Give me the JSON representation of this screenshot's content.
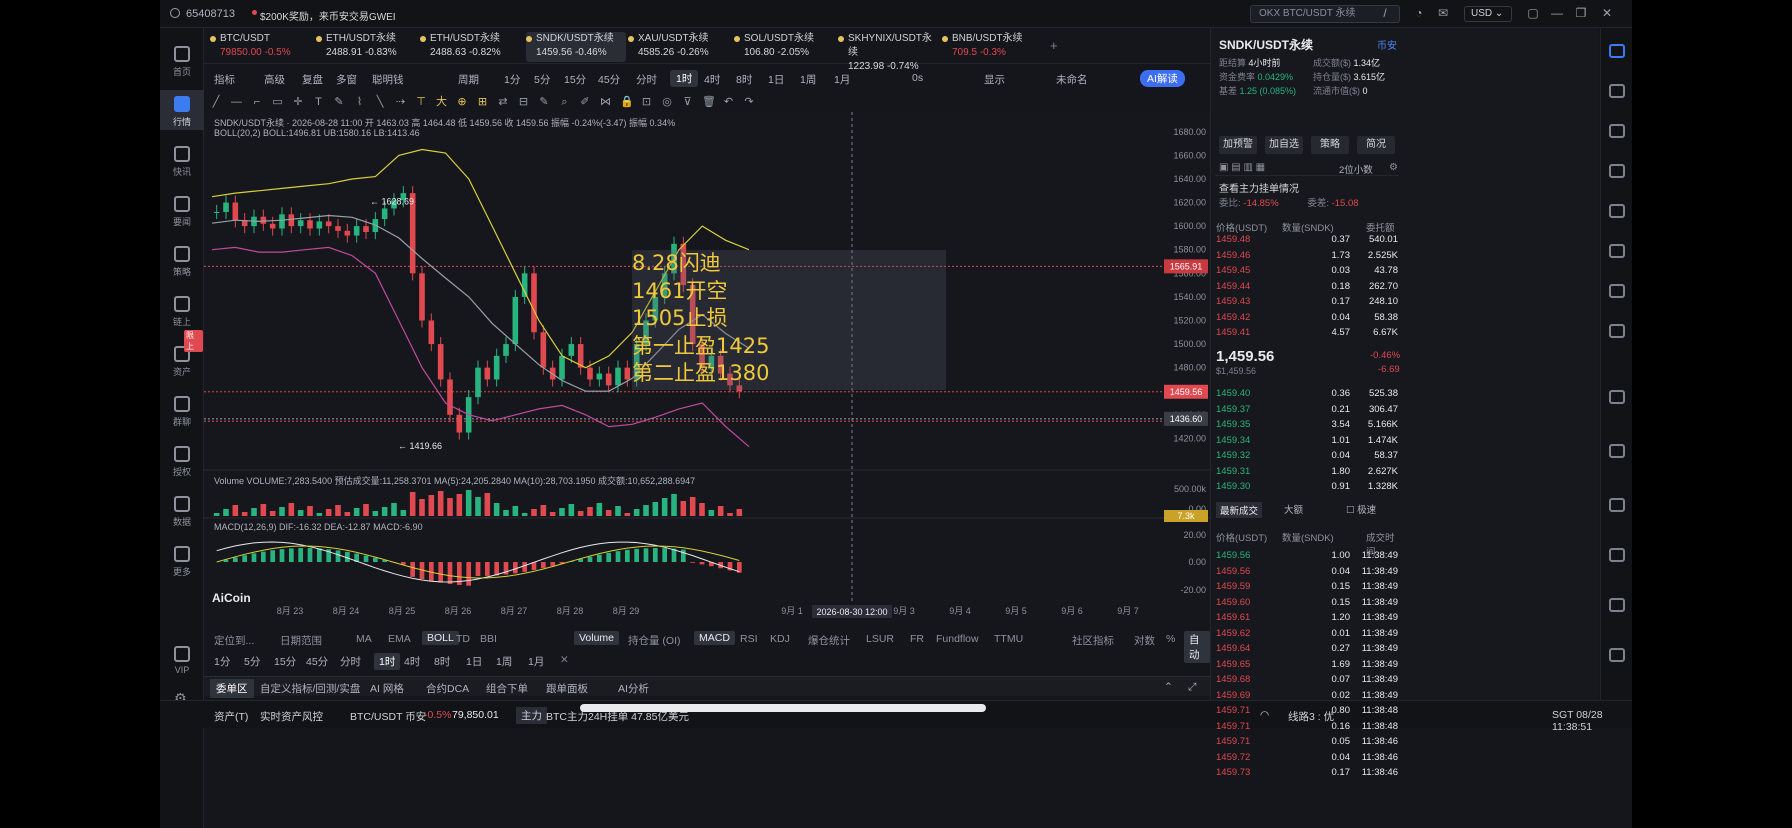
{
  "titlebar": {
    "uid": "65408713",
    "promo": "$200K奖励，来币安交易GWEI",
    "search_placeholder": "OKX BTC/USDT 永续",
    "currency": "USD"
  },
  "leftnav": [
    "首页",
    "行情",
    "快讯",
    "要闻",
    "策略",
    "链上",
    "资产",
    "群聊",
    "授权",
    "数据",
    "更多",
    "VIP"
  ],
  "leftnav_badge": "限上",
  "tabs": [
    {
      "name": "BTC/USDT",
      "price": "79850.00",
      "chg": "-0.5%",
      "color": "red"
    },
    {
      "name": "ETH/USDT永续",
      "price": "2488.91",
      "chg": "-0.83%",
      "color": "white"
    },
    {
      "name": "ETH/USDT永续",
      "price": "2488.63",
      "chg": "-0.82%",
      "color": "white"
    },
    {
      "name": "SNDK/USDT永续",
      "price": "1459.56",
      "chg": "-0.46%",
      "color": "white"
    },
    {
      "name": "XAU/USDT永续",
      "price": "4585.26",
      "chg": "-0.26%",
      "color": "white"
    },
    {
      "name": "SOL/USDT永续",
      "price": "106.80",
      "chg": "-2.05%",
      "color": "white"
    },
    {
      "name": "SKHYNIX/USDT永续",
      "price": "1223.98",
      "chg": "-0.74%",
      "color": "white"
    },
    {
      "name": "BNB/USDT永续",
      "price": "709.5",
      "chg": "-0.3%",
      "color": "red"
    }
  ],
  "toolbar1": [
    "指标",
    "高级",
    "复盘",
    "多窗",
    "聪明钱",
    "周期",
    "1分",
    "5分",
    "15分",
    "45分",
    "分时",
    "1时",
    "4时",
    "8时",
    "1日",
    "1周",
    "1月",
    "0s",
    "显示",
    "未命名",
    "AI解读"
  ],
  "toolbar1_selected": "1时",
  "chart": {
    "title_line": "SNDK/USDT永续 · 2026-08-28 11:00  开 1463.03  高 1464.48  低 1459.56  收 1459.56  振幅 -0.24%(-3.47)  振幅 0.34%",
    "boll_line": "BOLL(20,2)  BOLL:1496.81  UB:1580.16  LB:1413.46",
    "y_ticks": [
      "1680.00",
      "1660.00",
      "1640.00",
      "1620.00",
      "1600.00",
      "1580.00",
      "1560.00",
      "1540.00",
      "1520.00",
      "1500.00",
      "1480.00",
      "1460.00",
      "1440.00",
      "1420.00"
    ],
    "price_tags": {
      "line1": "1565.91",
      "current": "1459.56",
      "line2": "1436.60"
    },
    "high_label": "1628.69",
    "low_label": "1419.66",
    "annotation": [
      "8.28闪迪",
      "1461开空",
      "1505止损",
      "第一止盈1425",
      "第二止盈1380"
    ],
    "volume_line": "Volume  VOLUME:7,283.5400  预估成交量:11,258.3701  MA(5):24,205.2840  MA(10):28,703.1950  成交额:10,652,288.6947",
    "volume_ticks": [
      "500.00k",
      "0.00"
    ],
    "volume_tag": "7.3k",
    "macd_line": "MACD(12,26,9)  DIF:-16.32  DEA:-12.87  MACD:-6.90",
    "macd_ticks": [
      "20.00",
      "0.00",
      "-20.00"
    ],
    "x_ticks": [
      "8月 23",
      "8月 24",
      "8月 25",
      "8月 26",
      "8月 27",
      "8月 28",
      "8月 29",
      "9月 1",
      "9月 2",
      "9月 3",
      "9月 4",
      "9月 5",
      "9月 6",
      "9月 7"
    ],
    "crosshair_time": "2026-08-30 12:00",
    "logo": "AiCoin"
  },
  "indicators": [
    "定位到...",
    "日期范围",
    "MA",
    "EMA",
    "BOLL",
    "TD",
    "BBI",
    "Volume",
    "持仓量 (OI)",
    "MACD",
    "RSI",
    "KDJ",
    "爆仓统计",
    "LSUR",
    "FR",
    "Fundflow",
    "TTMU",
    "社区指标",
    "对数",
    "%",
    "自动"
  ],
  "timeframes": [
    "1分",
    "5分",
    "15分",
    "45分",
    "分时",
    "1时",
    "4时",
    "8时",
    "1日",
    "1周",
    "1月"
  ],
  "bottom_tabs": [
    "委单区",
    "自定义指标/回测/实盘",
    "AI 网格",
    "合约DCA",
    "组合下单",
    "跟单面板",
    "AI分析"
  ],
  "statusbar": {
    "assets": "资产(T)",
    "risk": "实时资产风控",
    "btc": "BTC/USDT 币安",
    "btc_chg": "-0.5%",
    "btc_price": "79,850.01",
    "main": "主力",
    "main_text": "BTC主力24H挂单 47.85亿美元",
    "line": "线路3 : 优",
    "time": "SGT 08/28 11:38:51"
  },
  "right": {
    "pair": "SNDK/USDT永续",
    "exchange": "币安",
    "info": [
      [
        "距结算",
        "4小时前"
      ],
      [
        "成交额($)",
        "1.34亿"
      ],
      [
        "资金费率",
        "0.0429%"
      ],
      [
        "持仓量($)",
        "3.615亿"
      ],
      [
        "基差",
        "1.25 (0.085%)"
      ],
      [
        "流通市值($)",
        "0"
      ]
    ],
    "buttons": [
      "加预警",
      "加自选",
      "策略",
      "简况"
    ],
    "depth_title": "查看主力挂单情况",
    "precision": "2位小数",
    "weibi": "委比:",
    "weibi_val": "-14.85%",
    "weicha": "委差:",
    "weicha_val": "-15.08",
    "ob_head": [
      "价格(USDT)",
      "数量(SNDK)",
      "委托额"
    ],
    "asks": [
      [
        "1459.48",
        "0.37",
        "540.01"
      ],
      [
        "1459.46",
        "1.73",
        "2.525K"
      ],
      [
        "1459.45",
        "0.03",
        "43.78"
      ],
      [
        "1459.44",
        "0.18",
        "262.70"
      ],
      [
        "1459.43",
        "0.17",
        "248.10"
      ],
      [
        "1459.42",
        "0.04",
        "58.38"
      ],
      [
        "1459.41",
        "4.57",
        "6.67K"
      ]
    ],
    "last_price": "1,459.56",
    "last_sub": "$1,459.56",
    "last_chg": "-0.46%",
    "last_diff": "-6.69",
    "bids": [
      [
        "1459.40",
        "0.36",
        "525.38"
      ],
      [
        "1459.37",
        "0.21",
        "306.47"
      ],
      [
        "1459.35",
        "3.54",
        "5.166K"
      ],
      [
        "1459.34",
        "1.01",
        "1.474K"
      ],
      [
        "1459.32",
        "0.04",
        "58.37"
      ],
      [
        "1459.31",
        "1.80",
        "2.627K"
      ],
      [
        "1459.30",
        "0.91",
        "1.328K"
      ]
    ],
    "trades_tabs": [
      "最新成交",
      "大额",
      "极速"
    ],
    "trades_head": [
      "价格(USDT)",
      "数量(SNDK)",
      "成交时间"
    ],
    "trades": [
      [
        "1459.56",
        "1.00",
        "11:38:49"
      ],
      [
        "1459.56",
        "0.04",
        "11:38:49"
      ],
      [
        "1459.59",
        "0.15",
        "11:38:49"
      ],
      [
        "1459.60",
        "0.15",
        "11:38:49"
      ],
      [
        "1459.61",
        "1.20",
        "11:38:49"
      ],
      [
        "1459.62",
        "0.01",
        "11:38:49"
      ],
      [
        "1459.64",
        "0.27",
        "11:38:49"
      ],
      [
        "1459.65",
        "1.69",
        "11:38:49"
      ],
      [
        "1459.68",
        "0.07",
        "11:38:49"
      ],
      [
        "1459.69",
        "0.02",
        "11:38:49"
      ],
      [
        "1459.71",
        "0.80",
        "11:38:48"
      ],
      [
        "1459.71",
        "0.16",
        "11:38:48"
      ],
      [
        "1459.71",
        "0.05",
        "11:38:46"
      ],
      [
        "1459.72",
        "0.04",
        "11:38:46"
      ],
      [
        "1459.73",
        "0.17",
        "11:38:46"
      ]
    ]
  },
  "chart_data": {
    "type": "candlestick",
    "title": "SNDK/USDT永续",
    "ylim": [
      1400,
      1690
    ],
    "x": [
      "8月 23",
      "8月 24",
      "8月 25",
      "8月 26",
      "8月 27",
      "8月 28"
    ],
    "close_series": [
      1612,
      1620,
      1605,
      1600,
      1608,
      1602,
      1598,
      1610,
      1600,
      1605,
      1598,
      1604,
      1600,
      1596,
      1592,
      1600,
      1595,
      1606,
      1615,
      1622,
      1628,
      1560,
      1520,
      1500,
      1470,
      1440,
      1425,
      1455,
      1480,
      1470,
      1490,
      1500,
      1540,
      1560,
      1510,
      1480,
      1470,
      1490,
      1500,
      1480,
      1470,
      1475,
      1465,
      1480,
      1470,
      1500,
      1520,
      1540,
      1560,
      1585,
      1550,
      1500,
      1480,
      1490,
      1475,
      1465,
      1460
    ],
    "ub_series": [
      1625,
      1628,
      1630,
      1632,
      1634,
      1636,
      1640,
      1642,
      1660,
      1665,
      1662,
      1640,
      1600,
      1560,
      1520,
      1490,
      1480,
      1490,
      1510,
      1545,
      1580,
      1600,
      1588,
      1580
    ],
    "lb_series": [
      1580,
      1582,
      1578,
      1578,
      1580,
      1582,
      1575,
      1560,
      1520,
      1480,
      1450,
      1440,
      1435,
      1440,
      1445,
      1448,
      1440,
      1430,
      1432,
      1438,
      1445,
      1450,
      1430,
      1413
    ]
  }
}
